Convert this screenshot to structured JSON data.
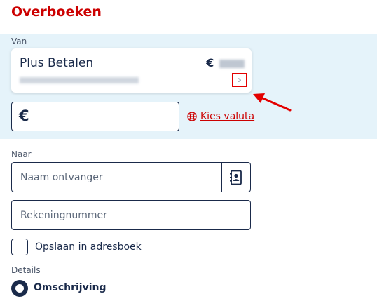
{
  "page": {
    "title": "Overboeken"
  },
  "from": {
    "label": "Van",
    "account_name": "Plus Betalen",
    "currency_symbol": "€",
    "chevron": "›",
    "amount_symbol": "€",
    "currency_link": "Kies valuta"
  },
  "to": {
    "label": "Naar",
    "name_placeholder": "Naam ontvanger",
    "account_placeholder": "Rekeningnummer",
    "save_label": "Opslaan in adresboek"
  },
  "details": {
    "label": "Details",
    "option_label": "Omschrijving"
  },
  "colors": {
    "brand_red": "#cc0000",
    "navy": "#1a2a4a",
    "section_bg": "#e5f3fa"
  },
  "icons": [
    "chevron-right-icon",
    "globe-icon",
    "address-book-icon",
    "annotation-arrow-icon"
  ]
}
